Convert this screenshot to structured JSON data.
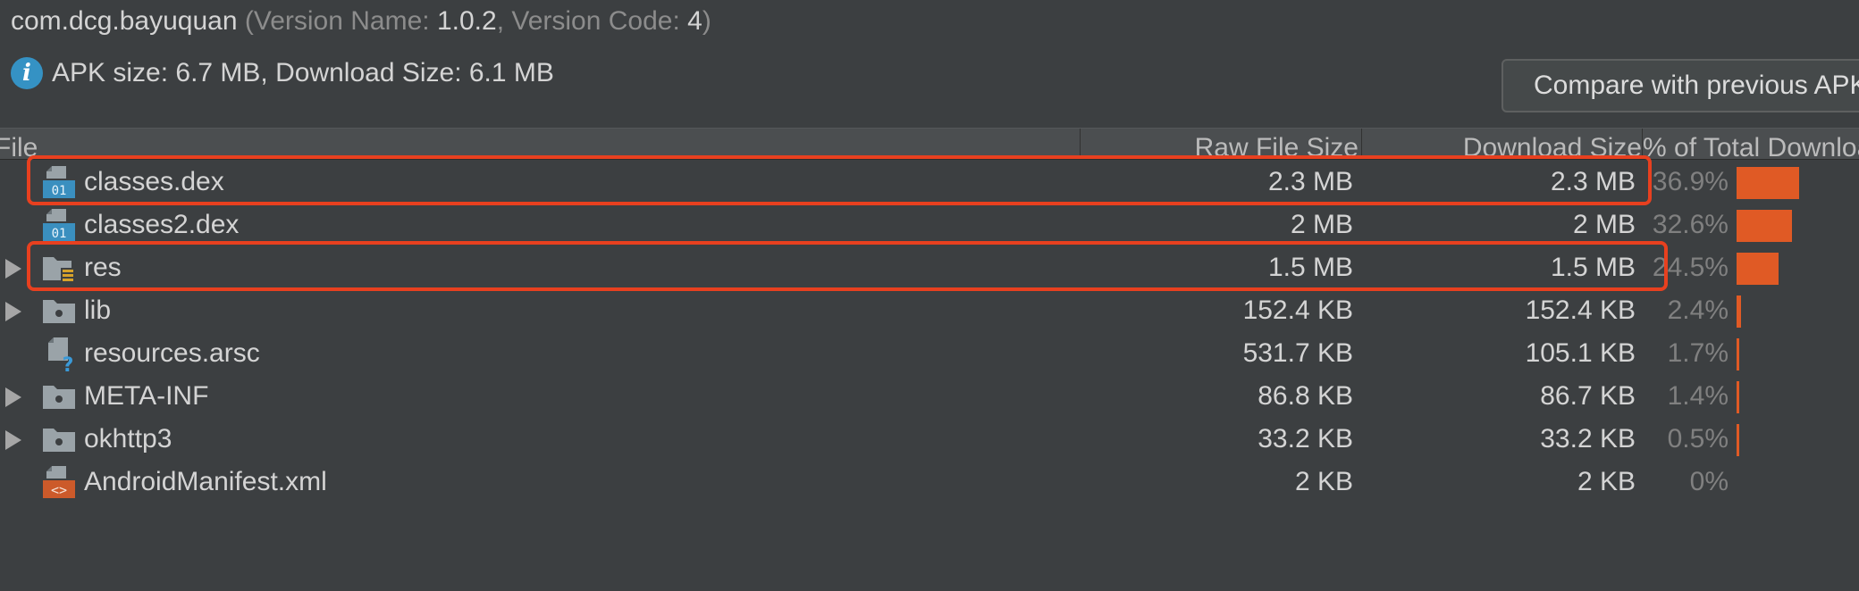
{
  "header": {
    "package": "com.dcg.bayuquan",
    "version_name_label": "(Version Name: ",
    "version_name": "1.0.2",
    "version_code_label": ", Version Code: ",
    "version_code": "4",
    "close_paren": ")"
  },
  "info": {
    "icon": "info-icon",
    "text": "APK size: 6.7 MB, Download Size: 6.1 MB"
  },
  "compare_button": {
    "label": "Compare with previous APK..."
  },
  "columns": {
    "file": "File",
    "raw": "Raw File Size",
    "download": "Download Size",
    "percent": "% of Total Download Size"
  },
  "rows": [
    {
      "name": "classes.dex",
      "raw": "2.3 MB",
      "download": "2.3 MB",
      "percent": "36.9%",
      "share": 0.369,
      "icon": "dex-file-icon",
      "expandable": false,
      "highlighted": true
    },
    {
      "name": "classes2.dex",
      "raw": "2 MB",
      "download": "2 MB",
      "percent": "32.6%",
      "share": 0.326,
      "icon": "dex-file-icon",
      "expandable": false,
      "highlighted": false
    },
    {
      "name": "res",
      "raw": "1.5 MB",
      "download": "1.5 MB",
      "percent": "24.5%",
      "share": 0.245,
      "icon": "resource-folder-icon",
      "expandable": true,
      "highlighted": true
    },
    {
      "name": "lib",
      "raw": "152.4 KB",
      "download": "152.4 KB",
      "percent": "2.4%",
      "share": 0.024,
      "icon": "folder-icon",
      "expandable": true,
      "highlighted": false
    },
    {
      "name": "resources.arsc",
      "raw": "531.7 KB",
      "download": "105.1 KB",
      "percent": "1.7%",
      "share": 0.017,
      "icon": "unknown-file-icon",
      "expandable": false,
      "highlighted": false
    },
    {
      "name": "META-INF",
      "raw": "86.8 KB",
      "download": "86.7 KB",
      "percent": "1.4%",
      "share": 0.014,
      "icon": "folder-icon",
      "expandable": true,
      "highlighted": false
    },
    {
      "name": "okhttp3",
      "raw": "33.2 KB",
      "download": "33.2 KB",
      "percent": "0.5%",
      "share": 0.005,
      "icon": "folder-icon",
      "expandable": true,
      "highlighted": false
    },
    {
      "name": "AndroidManifest.xml",
      "raw": "2 KB",
      "download": "2 KB",
      "percent": "0%",
      "share": 0.0,
      "icon": "xml-file-icon",
      "expandable": false,
      "highlighted": false
    }
  ],
  "colors": {
    "background": "#3c3f41",
    "bar": "#e05a25",
    "highlight": "#e8401f",
    "info_icon": "#3592c4"
  }
}
